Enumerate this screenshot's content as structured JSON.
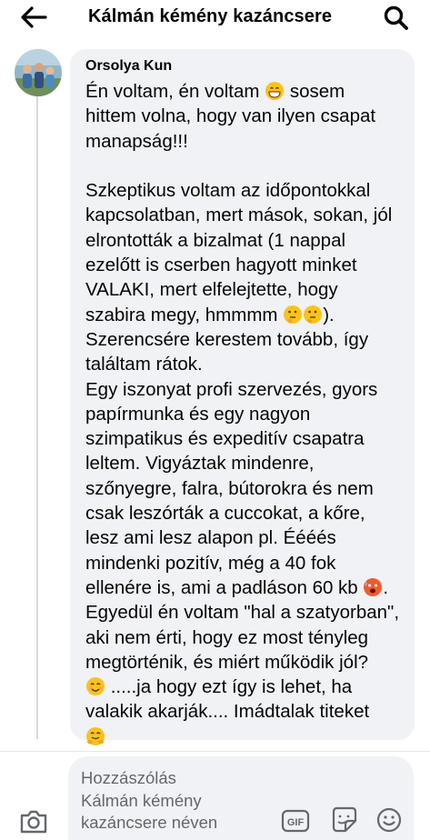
{
  "header": {
    "title": "Kálmán kémény kazáncsere",
    "back_icon": "arrow-left-icon",
    "search_icon": "search-icon"
  },
  "comment": {
    "author": "Orsolya Kun",
    "lines": [
      "Én voltam, én voltam",
      "sosem",
      "hittem volna, hogy van ilyen csapat",
      "manapság!!!",
      "",
      "Szkeptikus voltam az időpontokkal",
      "kapcsolatban, mert mások, sokan, jól",
      "elrontották a bizalmat (1 nappal",
      "ezelőtt is cserben hagyott minket",
      "VALAKI, mert elfelejtette, hogy",
      "szabira megy, hmmmm",
      ").",
      "Szerencsére kerestem tovább, így",
      "találtam  rátok.",
      "Egy iszonyat profi szervezés, gyors",
      "papírmunka és egy nagyon",
      "szimpatikus és expeditív csapatra",
      "leltem. Vigyáztak mindenre,",
      "szőnyegre, falra, bútorokra és nem",
      "csak leszórták a cuccokat, a kőre,",
      "lesz ami lesz alapon pl. Éééés",
      "mindenki pozitív, még a 40 fok",
      "ellenére is, ami a padláson 60 kb",
      "Egyedül én voltam \"hal a szatyorban\",",
      "aki nem érti, hogy ez most tényleg",
      "megtörténik, és miért működik jól?",
      " .....ja hogy ezt így is lehet, ha",
      "valakik akarják.... Imádtalak titeket"
    ],
    "emojis": [
      "grinning-face-icon",
      "thinking-face-icon",
      "hot-face-icon",
      "smiling-face-icon",
      "hugging-face-icon"
    ]
  },
  "composer": {
    "placeholder_lines": [
      "Hozzászólás",
      "Kálmán kémény",
      "kazáncsere néven"
    ],
    "camera_icon": "camera-icon",
    "gif_label": "GIF",
    "sticker_icon": "sticker-icon",
    "emoji_icon": "smile-icon"
  },
  "colors": {
    "bubble": "#f0f2f5",
    "text": "#050505",
    "secondary_text": "#65676b",
    "thread_line": "#d6d8dc"
  }
}
